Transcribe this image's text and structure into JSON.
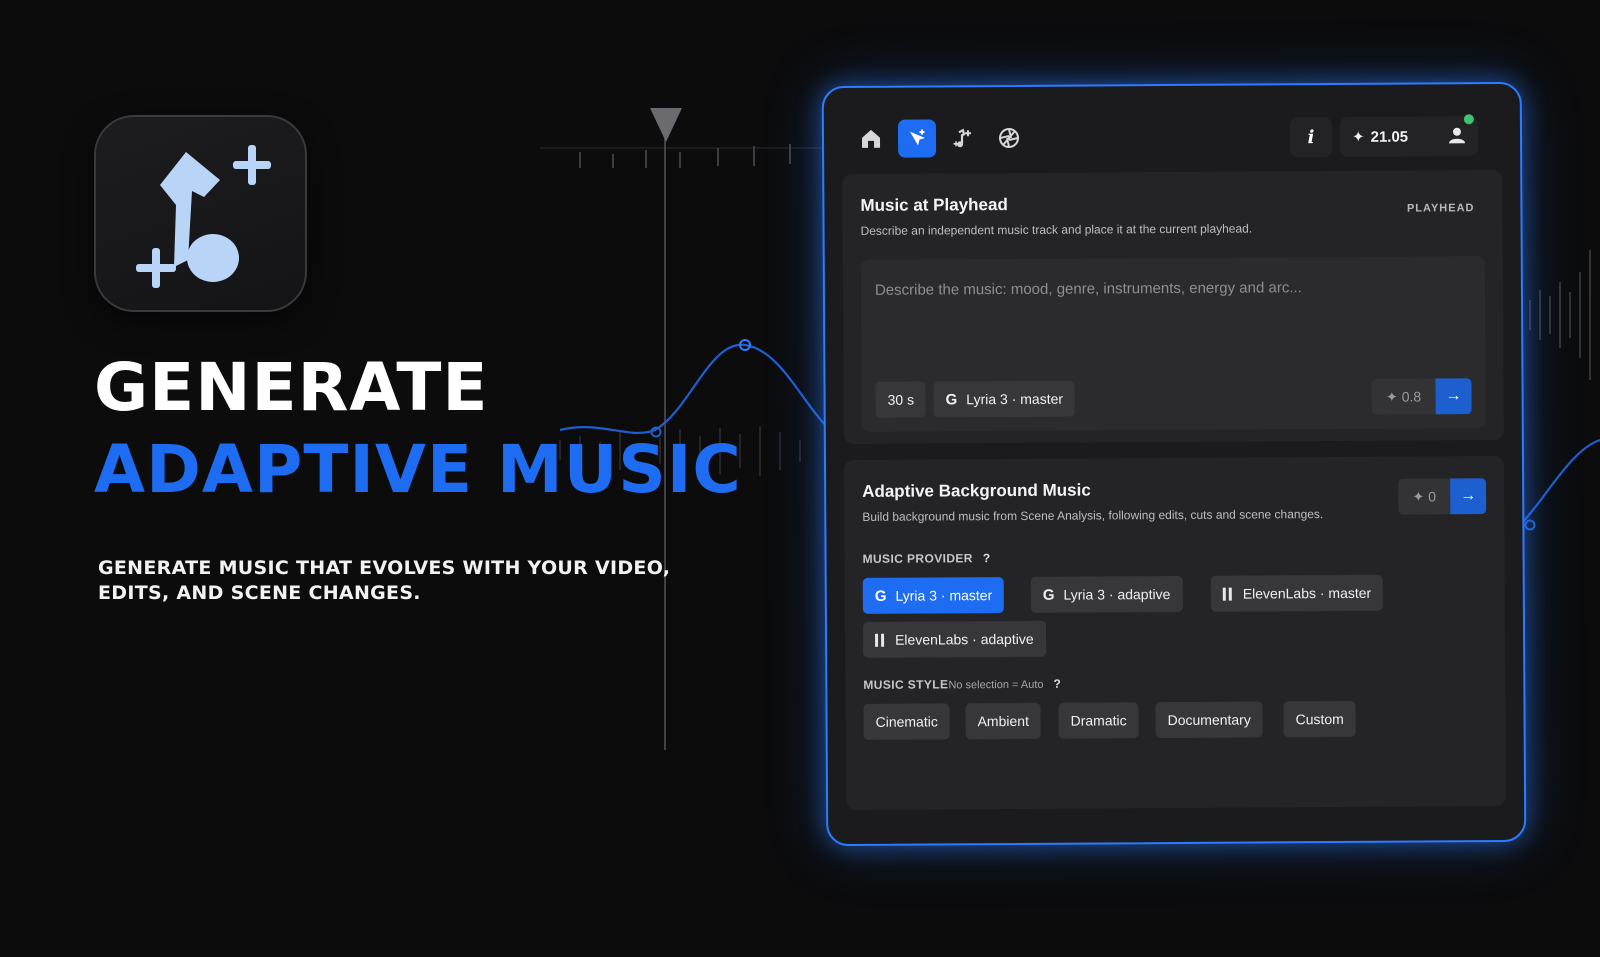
{
  "hero": {
    "headline_line1": "GENERATE",
    "headline_line2": "ADAPTIVE MUSIC",
    "subline": "GENERATE MUSIC THAT EVOLVES WITH YOUR VIDEO, EDITS, AND SCENE CHANGES.",
    "accent_color": "#1e6cf2"
  },
  "app_icon": {
    "icon": "music-note-sparkle-icon"
  },
  "topbar": {
    "nav": [
      {
        "icon": "home-icon",
        "active": false
      },
      {
        "icon": "magic-cursor-icon",
        "active": true
      },
      {
        "icon": "music-sparkle-icon",
        "active": false
      },
      {
        "icon": "aperture-icon",
        "active": false
      }
    ],
    "info_label": "i",
    "credits": "21.05",
    "status_color": "#3ec46d"
  },
  "playhead_section": {
    "title": "Music at Playhead",
    "description": "Describe an independent music track and place it at the current playhead.",
    "tag": "PLAYHEAD",
    "prompt_placeholder": "Describe the music: mood, genre, instruments, energy and arc...",
    "duration": "30 s",
    "model": "Lyria 3 · master",
    "cost": "0.8"
  },
  "adaptive_section": {
    "title": "Adaptive Background Music",
    "description": "Build background music from Scene Analysis, following edits, cuts and scene changes.",
    "cost": "0",
    "provider_label": "MUSIC PROVIDER",
    "help": "?",
    "providers": [
      {
        "label": "Lyria 3 · master",
        "icon": "google-icon",
        "selected": true
      },
      {
        "label": "Lyria 3 · adaptive",
        "icon": "google-icon",
        "selected": false
      },
      {
        "label": "ElevenLabs · master",
        "icon": "elevenlabs-icon",
        "selected": false
      },
      {
        "label": "ElevenLabs · adaptive",
        "icon": "elevenlabs-icon",
        "selected": false
      }
    ],
    "style_label": "MUSIC STYLE",
    "style_hint": "No selection = Auto",
    "styles": [
      "Cinematic",
      "Ambient",
      "Dramatic",
      "Documentary",
      "Custom"
    ]
  }
}
